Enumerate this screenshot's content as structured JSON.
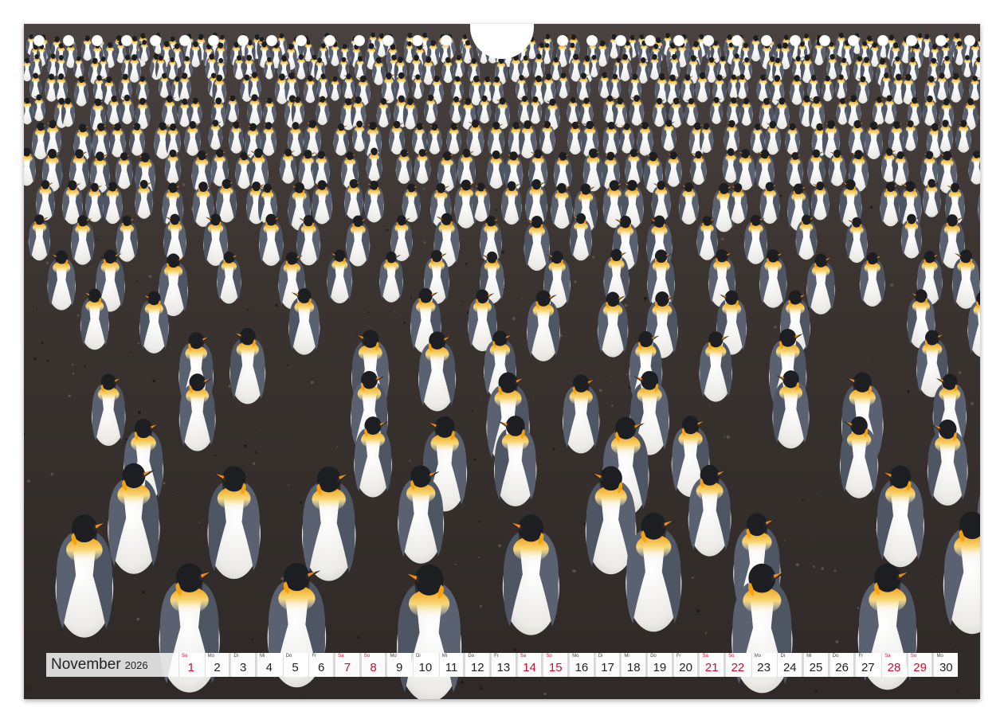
{
  "calendar": {
    "month": "November",
    "year": "2026",
    "days": [
      {
        "dow": "So",
        "num": "1",
        "weekend": true
      },
      {
        "dow": "Mo",
        "num": "2",
        "weekend": false
      },
      {
        "dow": "Di",
        "num": "3",
        "weekend": false
      },
      {
        "dow": "Mi",
        "num": "4",
        "weekend": false
      },
      {
        "dow": "Do",
        "num": "5",
        "weekend": false
      },
      {
        "dow": "Fr",
        "num": "6",
        "weekend": false
      },
      {
        "dow": "Sa",
        "num": "7",
        "weekend": true
      },
      {
        "dow": "So",
        "num": "8",
        "weekend": true
      },
      {
        "dow": "Mo",
        "num": "9",
        "weekend": false
      },
      {
        "dow": "Di",
        "num": "10",
        "weekend": false
      },
      {
        "dow": "Mi",
        "num": "11",
        "weekend": false
      },
      {
        "dow": "Do",
        "num": "12",
        "weekend": false
      },
      {
        "dow": "Fr",
        "num": "13",
        "weekend": false
      },
      {
        "dow": "Sa",
        "num": "14",
        "weekend": true
      },
      {
        "dow": "So",
        "num": "15",
        "weekend": true
      },
      {
        "dow": "Mo",
        "num": "16",
        "weekend": false
      },
      {
        "dow": "Di",
        "num": "17",
        "weekend": false
      },
      {
        "dow": "Mi",
        "num": "18",
        "weekend": false
      },
      {
        "dow": "Do",
        "num": "19",
        "weekend": false
      },
      {
        "dow": "Fr",
        "num": "20",
        "weekend": false
      },
      {
        "dow": "Sa",
        "num": "21",
        "weekend": true
      },
      {
        "dow": "So",
        "num": "22",
        "weekend": true
      },
      {
        "dow": "Mo",
        "num": "23",
        "weekend": false
      },
      {
        "dow": "Di",
        "num": "24",
        "weekend": false
      },
      {
        "dow": "Mi",
        "num": "25",
        "weekend": false
      },
      {
        "dow": "Do",
        "num": "26",
        "weekend": false
      },
      {
        "dow": "Fr",
        "num": "27",
        "weekend": false
      },
      {
        "dow": "Sa",
        "num": "28",
        "weekend": true
      },
      {
        "dow": "So",
        "num": "29",
        "weekend": true
      },
      {
        "dow": "Mo",
        "num": "30",
        "weekend": false
      }
    ]
  },
  "colors": {
    "weekend": "#c8102e",
    "ground": "#3a3330",
    "penguin_back": "#5d6470",
    "penguin_belly": "#f2f2f0",
    "penguin_orange": "#f2a516"
  },
  "photo": {
    "subject": "king-penguin-colony"
  }
}
